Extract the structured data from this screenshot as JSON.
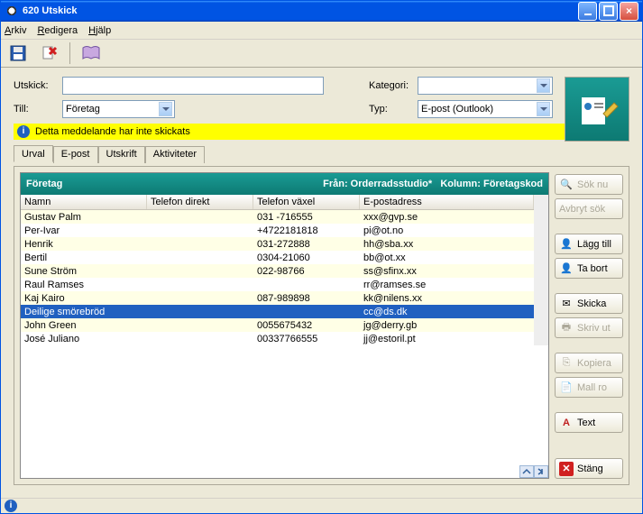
{
  "window": {
    "title": "620 Utskick"
  },
  "menu": {
    "arkiv": "Arkiv",
    "redigera": "Redigera",
    "hjalp": "Hjälp"
  },
  "form": {
    "utskick_label": "Utskick:",
    "utskick_value": "",
    "till_label": "Till:",
    "till_value": "Företag",
    "kategori_label": "Kategori:",
    "kategori_value": "",
    "typ_label": "Typ:",
    "typ_value": "E-post (Outlook)"
  },
  "notice": "Detta meddelande har inte skickats",
  "tabs": {
    "urval": "Urval",
    "epost": "E-post",
    "utskrift": "Utskrift",
    "aktiviteter": "Aktiviteter"
  },
  "table": {
    "title": "Företag",
    "from_label": "Från: Orderradsstudio*",
    "kolumn_label": "Kolumn: Företagskod",
    "columns": {
      "namn": "Namn",
      "tel_direkt": "Telefon direkt",
      "tel_vaxel": "Telefon växel",
      "epost": "E-postadress"
    },
    "rows": [
      {
        "namn": "Gustav Palm",
        "td": "",
        "tv": "031 -716555",
        "ep": "xxx@gvp.se"
      },
      {
        "namn": "Per-Ivar",
        "td": "",
        "tv": "+4722181818",
        "ep": "pi@ot.no"
      },
      {
        "namn": "Henrik",
        "td": "",
        "tv": "031-272888",
        "ep": "hh@sba.xx"
      },
      {
        "namn": "Bertil",
        "td": "",
        "tv": "0304-21060",
        "ep": "bb@ot.xx"
      },
      {
        "namn": "Sune Ström",
        "td": "",
        "tv": "022-98766",
        "ep": "ss@sfinx.xx"
      },
      {
        "namn": "Raul Ramses",
        "td": "",
        "tv": "",
        "ep": "rr@ramses.se"
      },
      {
        "namn": "Kaj Kairo",
        "td": "",
        "tv": "087-989898",
        "ep": "kk@nilens.xx"
      },
      {
        "namn": "Deilige smörebröd",
        "td": "",
        "tv": "",
        "ep": "cc@ds.dk"
      },
      {
        "namn": "John Green",
        "td": "",
        "tv": "0055675432",
        "ep": "jg@derry.gb"
      },
      {
        "namn": "José Juliano",
        "td": "",
        "tv": "00337766555",
        "ep": "jj@estoril.pt"
      }
    ],
    "selected_index": 7
  },
  "buttons": {
    "sok_nu": "Sök nu",
    "avbryt": "Avbryt sök",
    "lagg_till": "Lägg till",
    "ta_bort": "Ta bort",
    "skicka": "Skicka",
    "skriv_ut": "Skriv ut",
    "kopiera": "Kopiera",
    "mall_ro": "Mall ro",
    "text": "Text",
    "stang": "Stäng"
  }
}
